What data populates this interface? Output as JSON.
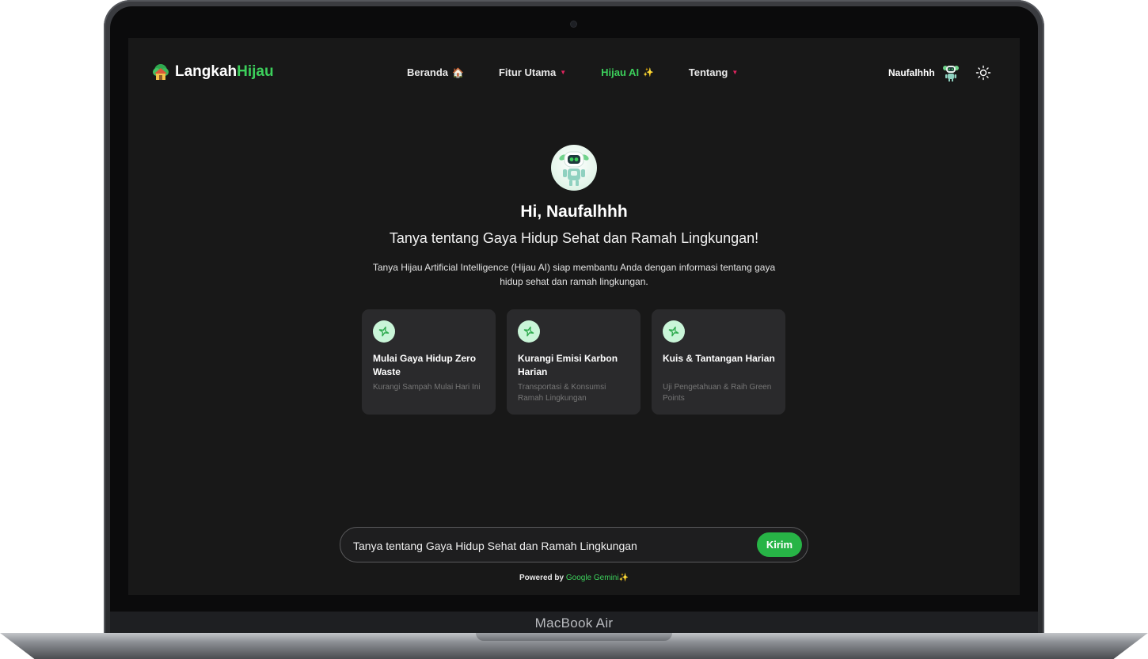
{
  "device": {
    "label": "MacBook Air"
  },
  "nav": {
    "brand_part1": "Langkah",
    "brand_part2": "Hijau",
    "menu": [
      {
        "label": "Beranda",
        "icon": "🏠",
        "dropdown": false
      },
      {
        "label": "Fitur Utama",
        "icon": "▼",
        "dropdown": true
      },
      {
        "label": "Hijau AI",
        "icon": "✨",
        "dropdown": false,
        "active": true
      },
      {
        "label": "Tentang",
        "icon": "▼",
        "dropdown": true
      }
    ],
    "user_name": "Naufalhhh"
  },
  "hero": {
    "greeting": "Hi, Naufalhhh",
    "subtitle": "Tanya tentang Gaya Hidup Sehat dan Ramah Lingkungan!",
    "description": "Tanya Hijau Artificial Intelligence (Hijau AI) siap membantu Anda dengan informasi tentang gaya hidup sehat dan ramah lingkungan."
  },
  "cards": [
    {
      "title": "Mulai Gaya Hidup Zero Waste",
      "subtitle": "Kurangi Sampah Mulai Hari Ini"
    },
    {
      "title": "Kurangi Emisi Karbon Harian",
      "subtitle": "Transportasi & Konsumsi Ramah Lingkungan"
    },
    {
      "title": "Kuis & Tantangan Harian",
      "subtitle": "Uji Pengetahuan & Raih Green Points"
    }
  ],
  "chat": {
    "placeholder": "Tanya tentang Gaya Hidup Sehat dan Ramah Lingkungan",
    "send_label": "Kirim"
  },
  "footer": {
    "powered_prefix": "Powered by",
    "powered_name": "Google Gemini",
    "powered_icon": "✨"
  },
  "colors": {
    "accent": "#3ccf5b",
    "background": "#181818",
    "card": "#2a2a2c",
    "caret": "#e0245e"
  }
}
